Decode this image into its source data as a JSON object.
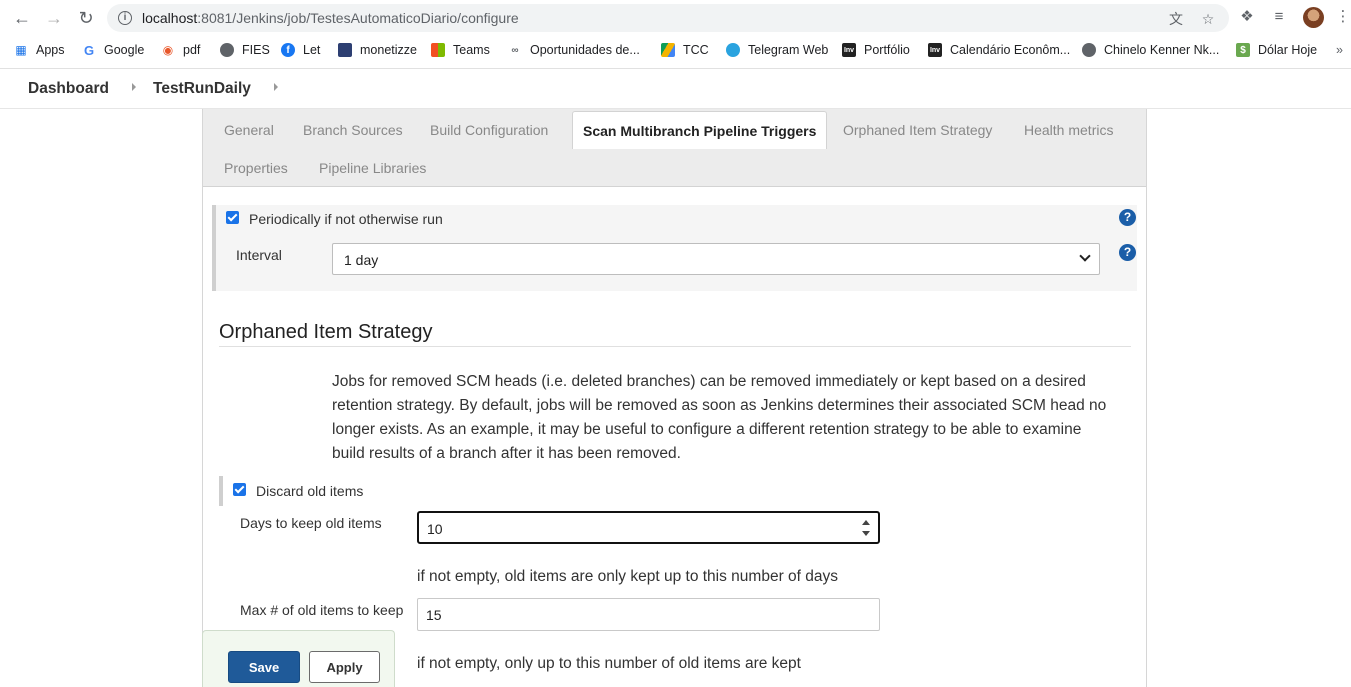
{
  "browser": {
    "url_host": "localhost",
    "url_path": ":8081/Jenkins/job/TestesAutomaticoDiario/configure",
    "bookmarks": [
      {
        "label": "Apps",
        "icon": "apps-grid-icon"
      },
      {
        "label": "Google",
        "icon": "google-icon"
      },
      {
        "label": "pdf",
        "icon": "pdf-icon"
      },
      {
        "label": "FIES",
        "icon": "globe-icon"
      },
      {
        "label": "Let",
        "icon": "facebook-icon"
      },
      {
        "label": "monetizze",
        "icon": "monetizze-icon"
      },
      {
        "label": "Teams",
        "icon": "microsoft-icon"
      },
      {
        "label": "Oportunidades de...",
        "icon": "link-icon"
      },
      {
        "label": "TCC",
        "icon": "drive-icon"
      },
      {
        "label": "Telegram Web",
        "icon": "telegram-icon"
      },
      {
        "label": "Portfólio",
        "icon": "investing-icon"
      },
      {
        "label": "Calendário Econôm...",
        "icon": "investing-icon"
      },
      {
        "label": "Chinelo Kenner Nk...",
        "icon": "globe-icon"
      },
      {
        "label": "Dólar Hoje",
        "icon": "dollar-icon"
      }
    ]
  },
  "breadcrumb": {
    "items": [
      "Dashboard",
      "TestRunDaily"
    ]
  },
  "tabs": {
    "row1": [
      "General",
      "Branch Sources",
      "Build Configuration",
      "Scan Multibranch Pipeline Triggers",
      "Orphaned Item Strategy",
      "Health metrics"
    ],
    "row2": [
      "Properties",
      "Pipeline Libraries"
    ],
    "active": "Scan Multibranch Pipeline Triggers"
  },
  "triggers": {
    "periodic_label": "Periodically if not otherwise run",
    "periodic_checked": true,
    "interval_label": "Interval",
    "interval_value": "1 day",
    "help": "?"
  },
  "orphaned": {
    "title": "Orphaned Item Strategy",
    "description": "Jobs for removed SCM heads (i.e. deleted branches) can be removed immediately or kept based on a desired retention strategy. By default, jobs will be removed as soon as Jenkins determines their associated SCM head no longer exists. As an example, it may be useful to configure a different retention strategy to be able to examine build results of a branch after it has been removed.",
    "discard_label": "Discard old items",
    "discard_checked": true,
    "days_label": "Days to keep old items",
    "days_value": "10",
    "days_hint": "if not empty, old items are only kept up to this number of days",
    "max_label": "Max # of old items to keep",
    "max_value": "15",
    "max_hint": "if not empty, only up to this number of old items are kept"
  },
  "actions": {
    "save": "Save",
    "apply": "Apply"
  },
  "colors": {
    "accent": "#1f5a99",
    "checkbox": "#1a73e8",
    "help": "#1b5ea8"
  }
}
